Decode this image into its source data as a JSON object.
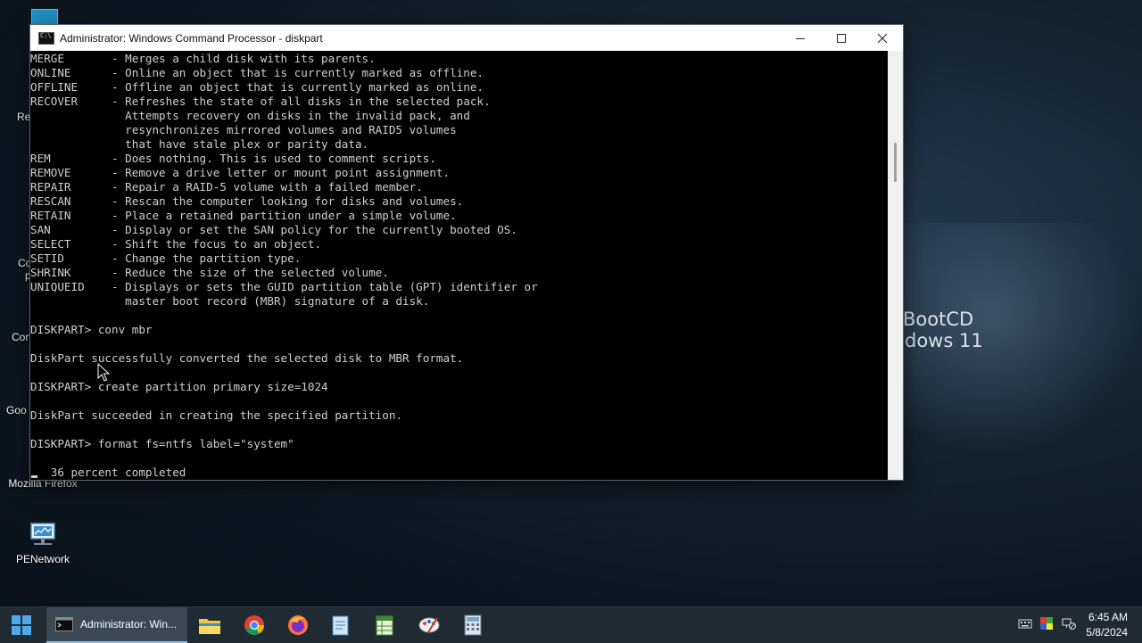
{
  "desktop": {
    "wallpaper_line1": "BootCD",
    "wallpaper_line2": "dows 11",
    "icons": [
      {
        "label": "Mozilla Firefox",
        "icon": "firefox-icon"
      },
      {
        "label": "PENetwork",
        "icon": "network-icon"
      }
    ],
    "partial_labels": [
      "Re",
      "Co",
      "p",
      "Con",
      "Goo"
    ]
  },
  "window": {
    "title": "Administrator: Windows Command Processor - diskpart",
    "console_lines": [
      "MERGE       - Merges a child disk with its parents.",
      "ONLINE      - Online an object that is currently marked as offline.",
      "OFFLINE     - Offline an object that is currently marked as online.",
      "RECOVER     - Refreshes the state of all disks in the selected pack.",
      "              Attempts recovery on disks in the invalid pack, and",
      "              resynchronizes mirrored volumes and RAID5 volumes",
      "              that have stale plex or parity data.",
      "REM         - Does nothing. This is used to comment scripts.",
      "REMOVE      - Remove a drive letter or mount point assignment.",
      "REPAIR      - Repair a RAID-5 volume with a failed member.",
      "RESCAN      - Rescan the computer looking for disks and volumes.",
      "RETAIN      - Place a retained partition under a simple volume.",
      "SAN         - Display or set the SAN policy for the currently booted OS.",
      "SELECT      - Shift the focus to an object.",
      "SETID       - Change the partition type.",
      "SHRINK      - Reduce the size of the selected volume.",
      "UNIQUEID    - Displays or sets the GUID partition table (GPT) identifier or",
      "              master boot record (MBR) signature of a disk.",
      "",
      "DISKPART> conv mbr",
      "",
      "DiskPart successfully converted the selected disk to MBR format.",
      "",
      "DISKPART> create partition primary size=1024",
      "",
      "DiskPart succeeded in creating the specified partition.",
      "",
      "DISKPART> format fs=ntfs label=\"system\"",
      "",
      "   36 percent completed"
    ]
  },
  "taskbar": {
    "task_label": "Administrator: Win...",
    "pinned": [
      "file-explorer-icon",
      "chrome-icon",
      "firefox-icon",
      "notepad-icon",
      "spreadsheet-icon",
      "paint-icon",
      "calculator-icon"
    ],
    "time": "6:45 AM",
    "date": "5/8/2024"
  }
}
